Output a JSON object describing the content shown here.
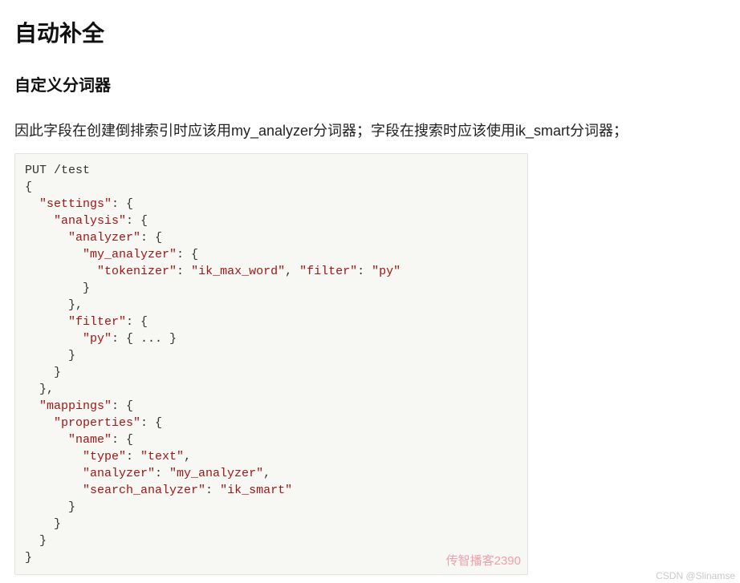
{
  "headings": {
    "title": "自动补全",
    "subtitle": "自定义分词器"
  },
  "paragraph": "因此字段在创建倒排索引时应该用my_analyzer分词器；字段在搜索时应该使用ik_smart分词器；",
  "code": {
    "request_line": "PUT /test",
    "keys": {
      "settings": "\"settings\"",
      "analysis": "\"analysis\"",
      "analyzer": "\"analyzer\"",
      "my_analyzer": "\"my_analyzer\"",
      "tokenizer": "\"tokenizer\"",
      "filter_key": "\"filter\"",
      "filter_block": "\"filter\"",
      "py_key": "\"py\"",
      "mappings": "\"mappings\"",
      "properties": "\"properties\"",
      "name": "\"name\"",
      "type": "\"type\"",
      "analyzer2": "\"analyzer\"",
      "search_analyzer": "\"search_analyzer\""
    },
    "vals": {
      "ik_max_word": "\"ik_max_word\"",
      "py_val": "\"py\"",
      "text": "\"text\"",
      "my_analyzer_val": "\"my_analyzer\"",
      "ik_smart": "\"ik_smart\""
    },
    "ellipsis": "{ ... }"
  },
  "watermarks": {
    "image": "传智播客2390",
    "page": "CSDN @Slinamse"
  }
}
